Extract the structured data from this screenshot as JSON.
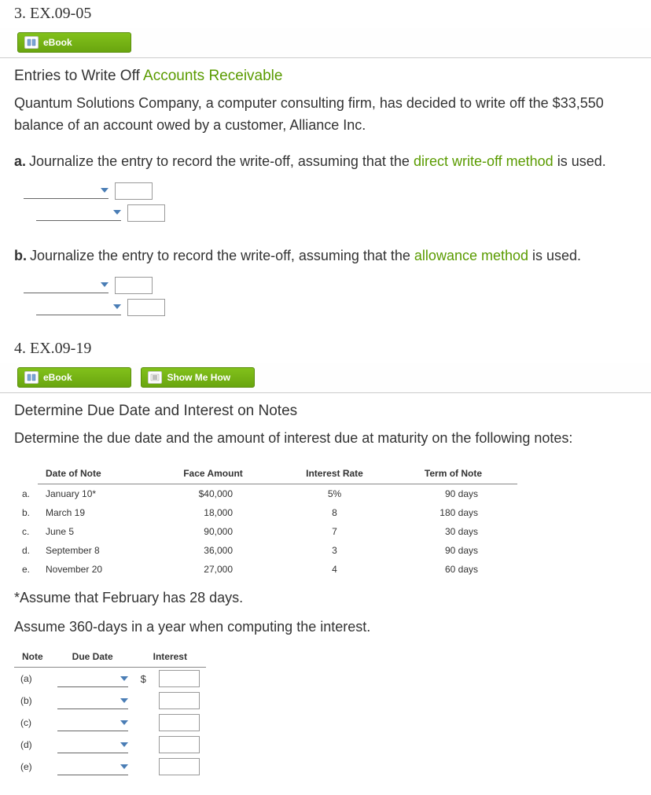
{
  "q3": {
    "header": "3. EX.09-05",
    "buttons": {
      "ebook": "eBook"
    },
    "title_prefix": "Entries to Write Off ",
    "title_link": "Accounts Receivable",
    "intro": "Quantum Solutions Company, a computer consulting firm, has decided to write off the $33,550 balance of an account owed by a customer, Alliance Inc.",
    "parts": {
      "a": {
        "lead": "a.",
        "before": "Journalize the entry to record the write-off, assuming that the ",
        "link": "direct write-off method",
        "after": " is used."
      },
      "b": {
        "lead": "b.",
        "before": "Journalize the entry to record the write-off, assuming that the ",
        "link": "allowance method",
        "after": " is used."
      }
    }
  },
  "q4": {
    "header": "4. EX.09-19",
    "buttons": {
      "ebook": "eBook",
      "show": "Show Me How"
    },
    "title": "Determine Due Date and Interest on Notes",
    "intro": "Determine the due date and the amount of interest due at maturity on the following notes:",
    "table_headers": {
      "date": "Date of Note",
      "face": "Face Amount",
      "rate": "Interest Rate",
      "term": "Term of Note"
    },
    "rows": [
      {
        "lbl": "a.",
        "date": "January 10*",
        "face": "$40,000",
        "rate": "5%",
        "term": "90 days"
      },
      {
        "lbl": "b.",
        "date": "March 19",
        "face": "18,000",
        "rate": "8",
        "term": "180 days"
      },
      {
        "lbl": "c.",
        "date": "June 5",
        "face": "90,000",
        "rate": "7",
        "term": "30 days"
      },
      {
        "lbl": "d.",
        "date": "September 8",
        "face": "36,000",
        "rate": "3",
        "term": "90 days"
      },
      {
        "lbl": "e.",
        "date": "November 20",
        "face": "27,000",
        "rate": "4",
        "term": "60 days"
      }
    ],
    "footnote1": "*Assume that February has 28 days.",
    "footnote2": "Assume 360-days in a year when computing the interest.",
    "answer_headers": {
      "note": "Note",
      "due": "Due Date",
      "interest": "Interest"
    },
    "answer_rows": [
      {
        "lbl": "(a)",
        "dollar": "$"
      },
      {
        "lbl": "(b)",
        "dollar": ""
      },
      {
        "lbl": "(c)",
        "dollar": ""
      },
      {
        "lbl": "(d)",
        "dollar": ""
      },
      {
        "lbl": "(e)",
        "dollar": ""
      }
    ]
  }
}
